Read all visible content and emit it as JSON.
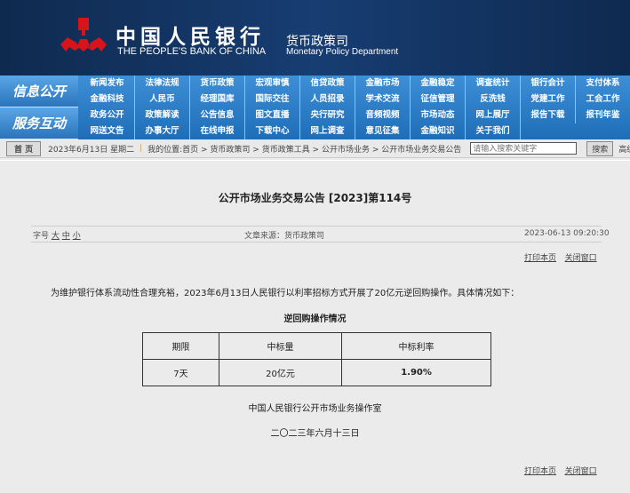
{
  "header": {
    "cn_title": "中国人民银行",
    "en_title": "THE PEOPLE'S BANK OF CHINA",
    "dept_cn": "货币政策司",
    "dept_en": "Monetary Policy Department"
  },
  "nav": {
    "label1": "信息公开",
    "label2": "服务互动",
    "rows": [
      [
        "新闻发布",
        "法律法规",
        "货币政策",
        "宏观审慎",
        "信贷政策",
        "金融市场",
        "金融稳定",
        "调查统计",
        "银行会计",
        "支付体系"
      ],
      [
        "金融科技",
        "人民币",
        "经理国库",
        "国际交往",
        "人员招录",
        "学术交流",
        "征信管理",
        "反洗钱",
        "党建工作",
        "工会工作"
      ],
      [
        "政务公开",
        "政策解读",
        "公告信息",
        "图文直播",
        "央行研究",
        "音频视频",
        "市场动态",
        "网上展厅",
        "报告下载",
        "报刊年鉴"
      ],
      [
        "网送文告",
        "办事大厅",
        "在线申报",
        "下载中心",
        "网上调查",
        "意见征集",
        "金融知识",
        "关于我们"
      ]
    ]
  },
  "crumb": {
    "home": "首 页",
    "date": "2023年6月13日 星期二",
    "location": "我的位置:首页 > 货币政策司 > 货币政策工具 > 公开市场业务 > 公开市场业务交易公告",
    "search_placeholder": "请输入搜索关键字",
    "search": "搜索",
    "advanced": "高级搜索"
  },
  "article": {
    "title": "公开市场业务交易公告 [2023]第114号",
    "font_label": "字号",
    "font_large": "大",
    "font_mid": "中",
    "font_small": "小",
    "source": "文章来源：货币政策司",
    "datetime": "2023-06-13 09:20:30",
    "print": "打印本页",
    "close": "关闭窗口",
    "para": "为维护银行体系流动性合理充裕，2023年6月13日人民银行以利率招标方式开展了20亿元逆回购操作。具体情况如下：",
    "table_title": "逆回购操作情况",
    "headers": [
      "期限",
      "中标量",
      "中标利率"
    ],
    "row": [
      "7天",
      "20亿元",
      "1.90%"
    ],
    "signature": "中国人民银行公开市场业务操作室",
    "date_cn": "二〇二三年六月十三日"
  }
}
